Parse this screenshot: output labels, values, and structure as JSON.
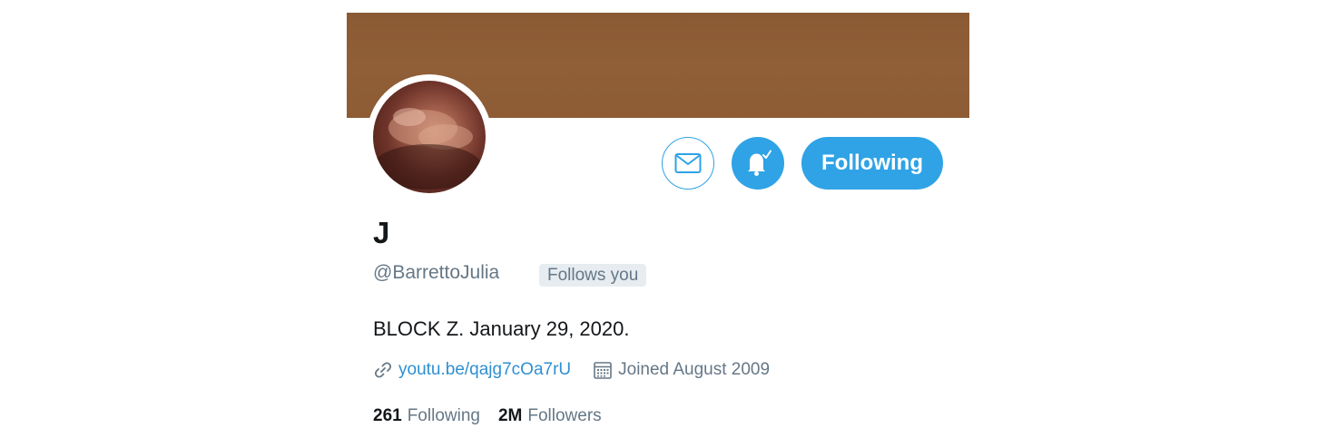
{
  "profile": {
    "name": "J",
    "handle": "@BarrettoJulia",
    "follows_you": "Follows you",
    "bio": "BLOCK Z. January 29, 2020.",
    "link": "youtu.be/qajg7cOa7rU",
    "joined": "Joined August 2009"
  },
  "actions": {
    "following_label": "Following",
    "message_icon": "envelope-icon",
    "notify_icon": "bell-check-icon"
  },
  "stats": {
    "following_count": "261",
    "following_label": "Following",
    "followers_count": "2M",
    "followers_label": "Followers"
  },
  "colors": {
    "accent": "#2fa3e6",
    "link": "#2f8fd1",
    "banner": "#8d5c35",
    "muted": "#657786",
    "text": "#14171a"
  }
}
